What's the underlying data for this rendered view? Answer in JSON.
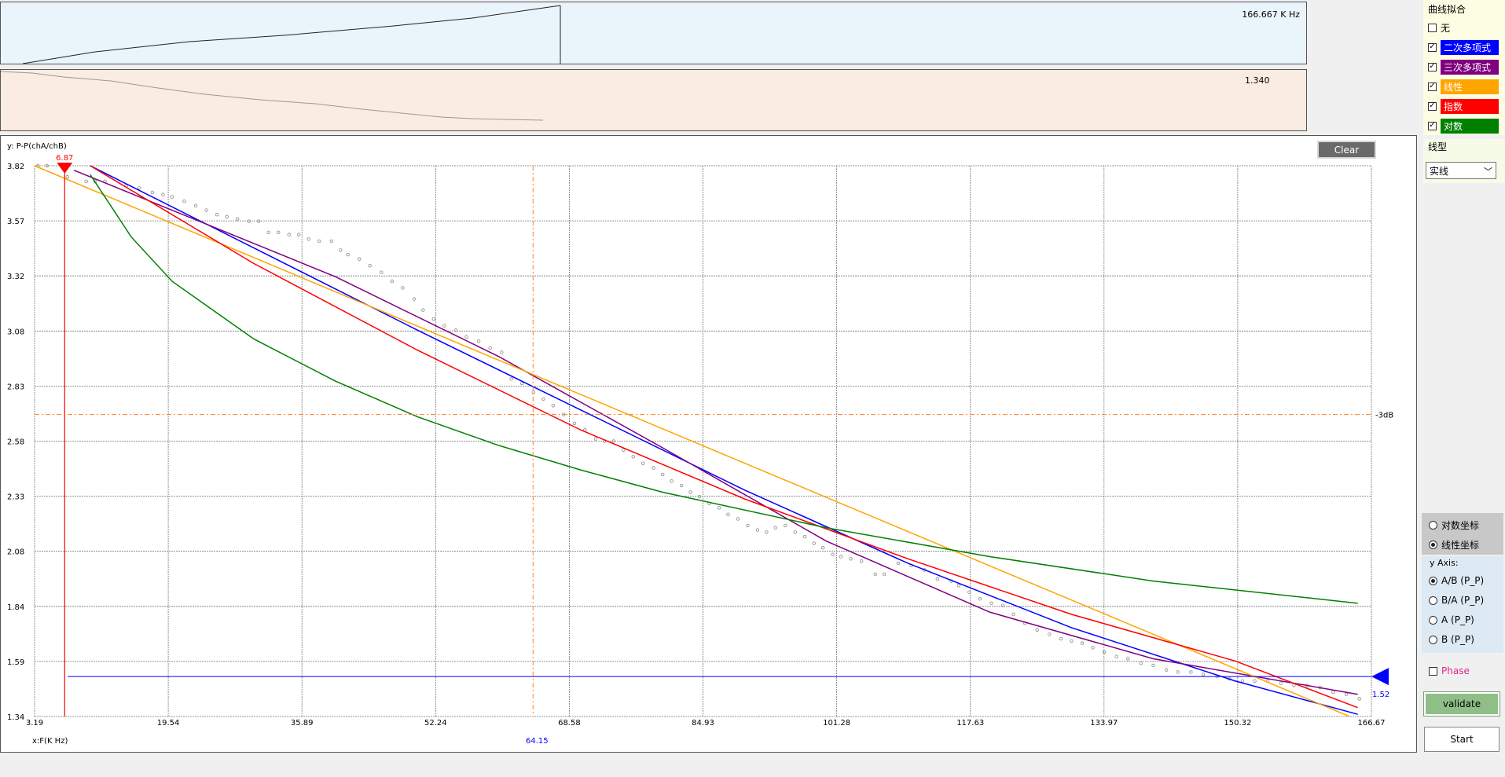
{
  "freq_panel": {
    "readout": "166.667 K Hz"
  },
  "value_panel": {
    "readout": "1.340"
  },
  "curve_fit": {
    "title": "曲线拟合",
    "options": [
      {
        "label": "无",
        "checked": false,
        "color": ""
      },
      {
        "label": "二次多项式",
        "checked": true,
        "color": "#0000ff"
      },
      {
        "label": "三次多项式",
        "checked": true,
        "color": "#800080"
      },
      {
        "label": "线性",
        "checked": true,
        "color": "#ffa500"
      },
      {
        "label": "指数",
        "checked": true,
        "color": "#ff0000"
      },
      {
        "label": "对数",
        "checked": true,
        "color": "#008000"
      }
    ]
  },
  "line_type": {
    "title": "线型",
    "selected": "实线"
  },
  "coord_mode": {
    "options": [
      {
        "label": "对数坐标",
        "selected": false
      },
      {
        "label": "线性坐标",
        "selected": true
      }
    ]
  },
  "y_axis_select": {
    "title": "y Axis:",
    "options": [
      {
        "label": "A/B (P_P)",
        "selected": true
      },
      {
        "label": "B/A (P_P)",
        "selected": false
      },
      {
        "label": "A (P_P)",
        "selected": false
      },
      {
        "label": "B (P_P)",
        "selected": false
      }
    ]
  },
  "phase": {
    "label": "Phase",
    "checked": false,
    "color": "#e0288c"
  },
  "buttons": {
    "clear": "Clear",
    "validate": "validate",
    "start": "Start"
  },
  "chart_data": {
    "type": "scatter",
    "ylabel": "y: P-P(chA/chB)",
    "xlabel": "x:F(K Hz)",
    "xlim": [
      3.19,
      166.67
    ],
    "ylim": [
      1.34,
      3.82
    ],
    "x_ticks": [
      "3.19",
      "19.54",
      "35.89",
      "52.24",
      "68.58",
      "84.93",
      "101.28",
      "117.63",
      "133.97",
      "150.32",
      "166.67"
    ],
    "y_ticks": [
      "3.82",
      "3.57",
      "3.32",
      "3.08",
      "2.83",
      "2.58",
      "2.33",
      "2.08",
      "1.84",
      "1.59",
      "1.34"
    ],
    "grid": true,
    "markers": {
      "cursor_x": {
        "value": 6.87,
        "label": "6.87",
        "color": "#ff0000"
      },
      "db3_x": {
        "value": 64.15,
        "label": "64.15",
        "color": "#0000ff"
      },
      "db3_y": {
        "value": 2.7,
        "label": "-3dB",
        "color": "#ff7f27"
      },
      "level_y": {
        "value": 1.52,
        "label": "1.52",
        "color": "#0000ff"
      }
    },
    "points": [
      [
        3.6,
        3.82
      ],
      [
        4.7,
        3.82
      ],
      [
        7.2,
        3.77
      ],
      [
        9.5,
        3.75
      ],
      [
        10.6,
        3.75
      ],
      [
        11.8,
        3.75
      ],
      [
        14.4,
        3.73
      ],
      [
        16.0,
        3.72
      ],
      [
        17.6,
        3.7
      ],
      [
        18.9,
        3.69
      ],
      [
        20.0,
        3.68
      ],
      [
        21.5,
        3.66
      ],
      [
        22.9,
        3.64
      ],
      [
        24.2,
        3.62
      ],
      [
        25.5,
        3.6
      ],
      [
        26.7,
        3.59
      ],
      [
        28.0,
        3.58
      ],
      [
        29.4,
        3.57
      ],
      [
        30.6,
        3.57
      ],
      [
        31.8,
        3.52
      ],
      [
        33.0,
        3.52
      ],
      [
        34.3,
        3.51
      ],
      [
        35.5,
        3.51
      ],
      [
        36.7,
        3.49
      ],
      [
        38.0,
        3.48
      ],
      [
        39.5,
        3.48
      ],
      [
        40.6,
        3.44
      ],
      [
        41.5,
        3.42
      ],
      [
        42.9,
        3.4
      ],
      [
        44.2,
        3.37
      ],
      [
        45.6,
        3.34
      ],
      [
        46.9,
        3.3
      ],
      [
        48.2,
        3.27
      ],
      [
        49.6,
        3.22
      ],
      [
        50.7,
        3.17
      ],
      [
        52.0,
        3.13
      ],
      [
        53.3,
        3.1
      ],
      [
        54.7,
        3.08
      ],
      [
        56.0,
        3.05
      ],
      [
        57.5,
        3.03
      ],
      [
        58.9,
        3.0
      ],
      [
        60.3,
        2.98
      ],
      [
        61.5,
        2.86
      ],
      [
        62.8,
        2.84
      ],
      [
        64.2,
        2.8
      ],
      [
        65.4,
        2.77
      ],
      [
        66.6,
        2.74
      ],
      [
        67.9,
        2.7
      ],
      [
        69.2,
        2.66
      ],
      [
        70.5,
        2.63
      ],
      [
        71.8,
        2.59
      ],
      [
        72.9,
        2.58
      ],
      [
        74.0,
        2.58
      ],
      [
        75.2,
        2.54
      ],
      [
        76.4,
        2.51
      ],
      [
        77.6,
        2.48
      ],
      [
        78.9,
        2.46
      ],
      [
        80.0,
        2.43
      ],
      [
        81.1,
        2.4
      ],
      [
        82.3,
        2.38
      ],
      [
        83.4,
        2.35
      ],
      [
        84.5,
        2.33
      ],
      [
        85.7,
        2.3
      ],
      [
        86.9,
        2.28
      ],
      [
        88.0,
        2.25
      ],
      [
        89.2,
        2.23
      ],
      [
        90.4,
        2.2
      ],
      [
        91.6,
        2.18
      ],
      [
        92.7,
        2.17
      ],
      [
        93.8,
        2.19
      ],
      [
        95.0,
        2.2
      ],
      [
        96.2,
        2.17
      ],
      [
        97.4,
        2.15
      ],
      [
        98.5,
        2.12
      ],
      [
        99.6,
        2.1
      ],
      [
        100.8,
        2.07
      ],
      [
        101.8,
        2.06
      ],
      [
        103.0,
        2.05
      ],
      [
        104.3,
        2.04
      ],
      [
        106.0,
        1.98
      ],
      [
        107.1,
        1.98
      ],
      [
        108.8,
        2.03
      ],
      [
        110.4,
        2.02
      ],
      [
        112.0,
        2.0
      ],
      [
        113.6,
        1.96
      ],
      [
        115.3,
        1.95
      ],
      [
        116.2,
        1.93
      ],
      [
        117.5,
        1.9
      ],
      [
        118.8,
        1.87
      ],
      [
        120.2,
        1.85
      ],
      [
        121.6,
        1.84
      ],
      [
        122.9,
        1.8
      ],
      [
        124.3,
        1.76
      ],
      [
        125.8,
        1.73
      ],
      [
        127.3,
        1.71
      ],
      [
        128.7,
        1.69
      ],
      [
        130.0,
        1.68
      ],
      [
        131.3,
        1.67
      ],
      [
        132.6,
        1.65
      ],
      [
        134.0,
        1.63
      ],
      [
        135.5,
        1.61
      ],
      [
        136.9,
        1.6
      ],
      [
        138.5,
        1.58
      ],
      [
        140.0,
        1.57
      ],
      [
        141.6,
        1.55
      ],
      [
        143.0,
        1.54
      ],
      [
        144.6,
        1.54
      ],
      [
        146.1,
        1.53
      ],
      [
        147.8,
        1.52
      ],
      [
        149.3,
        1.51
      ],
      [
        150.9,
        1.5
      ],
      [
        152.4,
        1.5
      ],
      [
        154.0,
        1.5
      ],
      [
        155.6,
        1.49
      ],
      [
        157.2,
        1.48
      ],
      [
        158.8,
        1.48
      ],
      [
        160.4,
        1.47
      ],
      [
        162.0,
        1.45
      ],
      [
        163.6,
        1.44
      ],
      [
        165.2,
        1.42
      ]
    ],
    "series": [
      {
        "name": "二次多项式",
        "color": "#0000ff",
        "x": [
          10,
          30,
          50,
          70,
          90,
          110,
          130,
          150,
          165
        ],
        "y": [
          3.82,
          3.45,
          3.08,
          2.72,
          2.36,
          2.03,
          1.74,
          1.5,
          1.35
        ]
      },
      {
        "name": "三次多项式",
        "color": "#800080",
        "x": [
          8,
          20,
          40,
          60,
          80,
          100,
          120,
          140,
          165
        ],
        "y": [
          3.8,
          3.62,
          3.32,
          2.96,
          2.55,
          2.13,
          1.81,
          1.6,
          1.44
        ]
      },
      {
        "name": "线性",
        "color": "#ffa500",
        "x": [
          3.19,
          164
        ],
        "y": [
          3.82,
          1.34
        ]
      },
      {
        "name": "指数",
        "color": "#ff0000",
        "x": [
          10,
          30,
          50,
          70,
          90,
          110,
          130,
          150,
          165
        ],
        "y": [
          3.82,
          3.38,
          2.99,
          2.63,
          2.32,
          2.05,
          1.8,
          1.59,
          1.38
        ]
      },
      {
        "name": "对数",
        "color": "#008000",
        "x": [
          10,
          15,
          20,
          30,
          40,
          50,
          60,
          70,
          80,
          100,
          120,
          140,
          165
        ],
        "y": [
          3.78,
          3.5,
          3.3,
          3.04,
          2.85,
          2.69,
          2.56,
          2.45,
          2.35,
          2.19,
          2.06,
          1.95,
          1.85
        ]
      }
    ]
  }
}
